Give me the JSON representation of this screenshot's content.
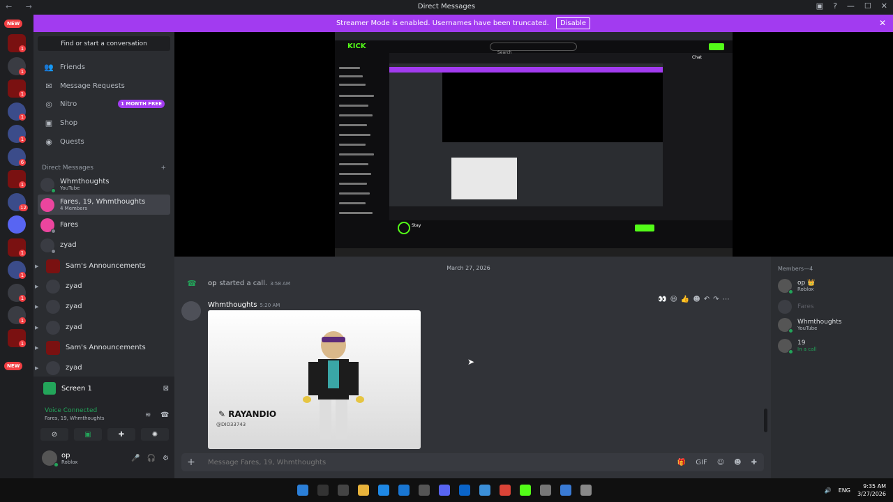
{
  "window": {
    "title": "Direct Messages",
    "nav": "← →",
    "controls": [
      "▣",
      "?",
      "—",
      "☐",
      "✕"
    ]
  },
  "banner": {
    "text": "Streamer Mode is enabled. Usernames have been truncated.",
    "button": "Disable",
    "close": "✕"
  },
  "guilds": {
    "new_label_top": "NEW",
    "new_label_bottom": "NEW",
    "items": [
      {
        "type": "rage",
        "badge": "1"
      },
      {
        "type": "plain",
        "badge": "1"
      },
      {
        "type": "rage",
        "badge": "1"
      },
      {
        "type": "blue",
        "badge": "1"
      },
      {
        "type": "blue",
        "badge": "1"
      },
      {
        "type": "blue",
        "badge": "6"
      },
      {
        "type": "rage",
        "badge": "1"
      },
      {
        "type": "blue",
        "badge": "12"
      },
      {
        "type": "dc",
        "badge": ""
      },
      {
        "type": "rage",
        "badge": "1"
      },
      {
        "type": "blue",
        "badge": "1"
      },
      {
        "type": "plain",
        "badge": "1"
      },
      {
        "type": "plain",
        "badge": "1"
      },
      {
        "type": "rage",
        "badge": "1"
      }
    ]
  },
  "sidebar": {
    "search": "Find or start a conversation",
    "nav": [
      {
        "label": "Friends",
        "icon": "👥"
      },
      {
        "label": "Message Requests",
        "icon": "✉"
      },
      {
        "label": "Nitro",
        "icon": "◎",
        "pill": "1 MONTH FREE"
      },
      {
        "label": "Shop",
        "icon": "▣"
      },
      {
        "label": "Quests",
        "icon": "◉"
      }
    ],
    "dm_header": "Direct Messages",
    "dm_add": "+",
    "dms": [
      {
        "name": "Whmthoughts",
        "sub": "YouTube"
      },
      {
        "name": "Fares, 19, Whmthoughts",
        "sub": "4 Members"
      },
      {
        "name": "Fares",
        "sub": ""
      },
      {
        "name": "zyad",
        "sub": ""
      },
      {
        "name": "Sam's Announcements",
        "sub": ""
      },
      {
        "name": "zyad",
        "sub": ""
      },
      {
        "name": "zyad",
        "sub": ""
      },
      {
        "name": "zyad",
        "sub": ""
      },
      {
        "name": "Sam's Announcements",
        "sub": ""
      },
      {
        "name": "zyad",
        "sub": ""
      }
    ]
  },
  "voice_panel": {
    "screen_label": "Screen 1",
    "status": "Voice Connected",
    "channel": "Fares, 19, Whmthoughts",
    "buttons": [
      "⊘",
      "▣",
      "✚",
      "✺"
    ],
    "user": {
      "name": "op",
      "sub": "Roblox"
    },
    "ctrls": [
      "🎤",
      "🎧",
      "⚙"
    ]
  },
  "stream": {
    "kick_logo": "KICK",
    "kick_search": "Search",
    "kick_chat": "Chat",
    "inner_tag": "RAYANDIO",
    "streamer": "Stay"
  },
  "chat": {
    "date": "March 27, 2026",
    "call": {
      "user": "op",
      "text": "started a call.",
      "time": "3:58 AM"
    },
    "reactions": [
      "👀",
      "😆",
      "👍",
      "☻",
      "↶",
      "↷",
      "⋯"
    ],
    "message": {
      "author": "Whmthoughts",
      "time": "5:20 AM",
      "embed_name": "✎ RAYANDIO",
      "embed_handle": "@DIO33743"
    },
    "composer_placeholder": "Message Fares, 19, Whmthoughts",
    "composer_tools": [
      "🎁",
      "GIF",
      "☺",
      "☻",
      "✚"
    ]
  },
  "members": {
    "header": "Members—4",
    "list": [
      {
        "name": "op 👑",
        "sub": "Roblox",
        "dim": false
      },
      {
        "name": "Fares",
        "sub": "",
        "dim": true
      },
      {
        "name": "Whmthoughts",
        "sub": "YouTube",
        "dim": false
      },
      {
        "name": "19",
        "sub": "In a call",
        "dim": false
      }
    ]
  },
  "taskbar": {
    "lang": "ENG",
    "time": "9:35 AM",
    "date": "3/27/2026"
  }
}
